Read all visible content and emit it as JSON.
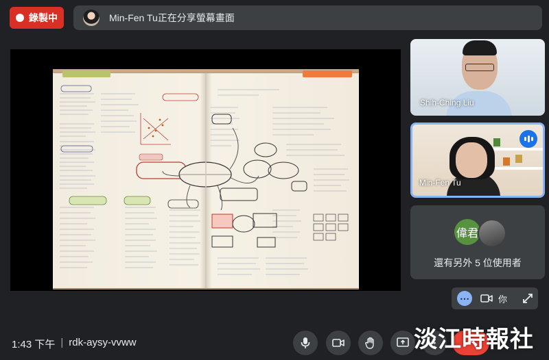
{
  "top_bar": {
    "recording_label": "錄製中",
    "presenter_text": "Min-Fen Tu正在分享螢幕畫面"
  },
  "participants": [
    {
      "name": "Shih-Ching Liu"
    },
    {
      "name": "Min-Fen Tu"
    }
  ],
  "others": {
    "avatar_1_text": "偉君",
    "label": "還有另外 5 位使用者"
  },
  "self_view": {
    "you_label": "你"
  },
  "bottom_bar": {
    "time": "1:43 下午",
    "separator": "|",
    "meeting_code": "rdk-aysy-vvww"
  },
  "watermark": "淡江時報社",
  "colors": {
    "recording": "#d93025",
    "end_call": "#ea4335",
    "accent": "#8ab4f8",
    "speaking": "#1a73e8"
  }
}
